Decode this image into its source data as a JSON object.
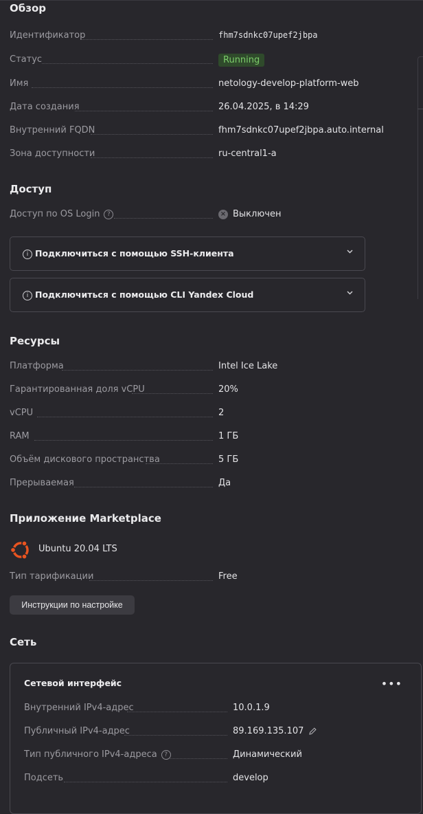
{
  "overview": {
    "heading": "Обзор",
    "rows": [
      {
        "key": "Идентификатор",
        "value": "fhm7sdnkc07upef2jbpa"
      },
      {
        "key": "Статус",
        "value": "Running"
      },
      {
        "key": "Имя",
        "value": "netology-develop-platform-web"
      },
      {
        "key": "Дата создания",
        "value": "26.04.2025, в 14:29"
      },
      {
        "key": "Внутренний FQDN",
        "value": "fhm7sdnkc07upef2jbpa.auto.internal"
      },
      {
        "key": "Зона доступности",
        "value": "ru-central1-a"
      }
    ]
  },
  "access": {
    "heading": "Доступ",
    "os_login_key": "Доступ по OS Login",
    "os_login_value": "Выключен",
    "accordions": [
      "Подключиться с помощью SSH-клиента",
      "Подключиться с помощью CLI Yandex Cloud"
    ]
  },
  "resources": {
    "heading": "Ресурсы",
    "rows": [
      {
        "key": "Платформа",
        "value": "Intel Ice Lake"
      },
      {
        "key": "Гарантированная доля vCPU",
        "value": "20%"
      },
      {
        "key": "vCPU",
        "value": "2"
      },
      {
        "key": "RAM",
        "value": "1 ГБ"
      },
      {
        "key": "Объём дискового пространства",
        "value": "5 ГБ"
      },
      {
        "key": "Прерываемая",
        "value": "Да"
      }
    ]
  },
  "marketplace": {
    "heading": "Приложение Marketplace",
    "product": "Ubuntu 20.04 LTS",
    "tariff_key": "Тип тарификации",
    "tariff_value": "Free",
    "instructions_button": "Инструкции по настройке"
  },
  "network": {
    "heading": "Сеть",
    "interface_title": "Сетевой интерфейс",
    "menu_label": "•••",
    "rows": [
      {
        "key": "Внутренний IPv4-адрес",
        "value": "10.0.1.9"
      },
      {
        "key": "Публичный IPv4-адрес",
        "value": "89.169.135.107"
      },
      {
        "key": "Тип публичного IPv4-адреса",
        "value": "Динамический"
      },
      {
        "key": "Подсеть",
        "value": "develop"
      }
    ]
  },
  "icons": {
    "help": "question-circle-icon",
    "disabled": "x-circle-icon",
    "info": "info-circle-icon",
    "chevron": "chevron-down-icon",
    "edit": "pencil-icon",
    "ubuntu": "ubuntu-logo-icon"
  },
  "colors": {
    "background": "#28272c",
    "status_running_bg": "#2f4a2b",
    "status_running_fg": "#7ccd6a",
    "link": "#5b8def",
    "ubuntu_orange": "#e95420"
  }
}
